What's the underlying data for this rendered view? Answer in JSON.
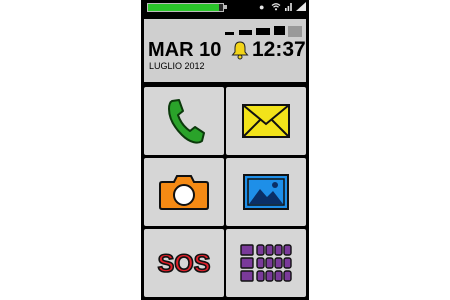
{
  "status": {
    "battery_level": 0.95,
    "battery_color": "#2bc52b",
    "wifi_icon": "wifi-icon",
    "signal_icon": "signal-icon",
    "network_icon": "network-icon"
  },
  "header": {
    "date": "MAR 10",
    "time": "12:37",
    "month_year": "LUGLIO 2012",
    "alarm_icon": "bell-icon"
  },
  "tiles": [
    {
      "name": "phone",
      "icon": "phone-icon"
    },
    {
      "name": "messages",
      "icon": "envelope-icon"
    },
    {
      "name": "camera",
      "icon": "camera-icon"
    },
    {
      "name": "gallery",
      "icon": "picture-icon"
    },
    {
      "name": "sos",
      "label": "SOS",
      "icon": "sos-icon"
    },
    {
      "name": "apps",
      "icon": "apps-grid-icon"
    }
  ],
  "colors": {
    "phone_green": "#2aa32a",
    "envelope_yellow": "#f2e31a",
    "camera_orange": "#f58a14",
    "picture_blue": "#1e8fe8",
    "sos_red": "#e0202a",
    "apps_purple": "#7a3a9a"
  }
}
